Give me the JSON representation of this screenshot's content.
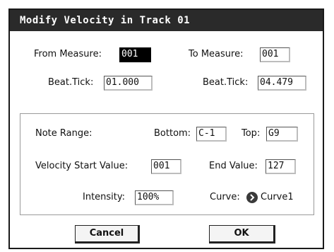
{
  "dialog": {
    "title": "Modify Velocity in Track 01"
  },
  "range": {
    "from_measure_label": "From Measure:",
    "from_measure_value": "001",
    "to_measure_label": "To Measure:",
    "to_measure_value": "001",
    "from_beat_label": "Beat.Tick:",
    "from_beat_value": "01.000",
    "to_beat_label": "Beat.Tick:",
    "to_beat_value": "04.479"
  },
  "params": {
    "note_range_label": "Note Range:",
    "bottom_label": "Bottom:",
    "bottom_value": "C-1",
    "top_label": "Top:",
    "top_value": "G9",
    "velocity_start_label": "Velocity Start Value:",
    "velocity_start_value": "001",
    "end_value_label": "End Value:",
    "end_value_value": "127",
    "intensity_label": "Intensity:",
    "intensity_value": "100%",
    "curve_label": "Curve:",
    "curve_icon": "chevron-right-icon",
    "curve_value": "Curve1"
  },
  "buttons": {
    "cancel": "Cancel",
    "ok": "OK"
  }
}
